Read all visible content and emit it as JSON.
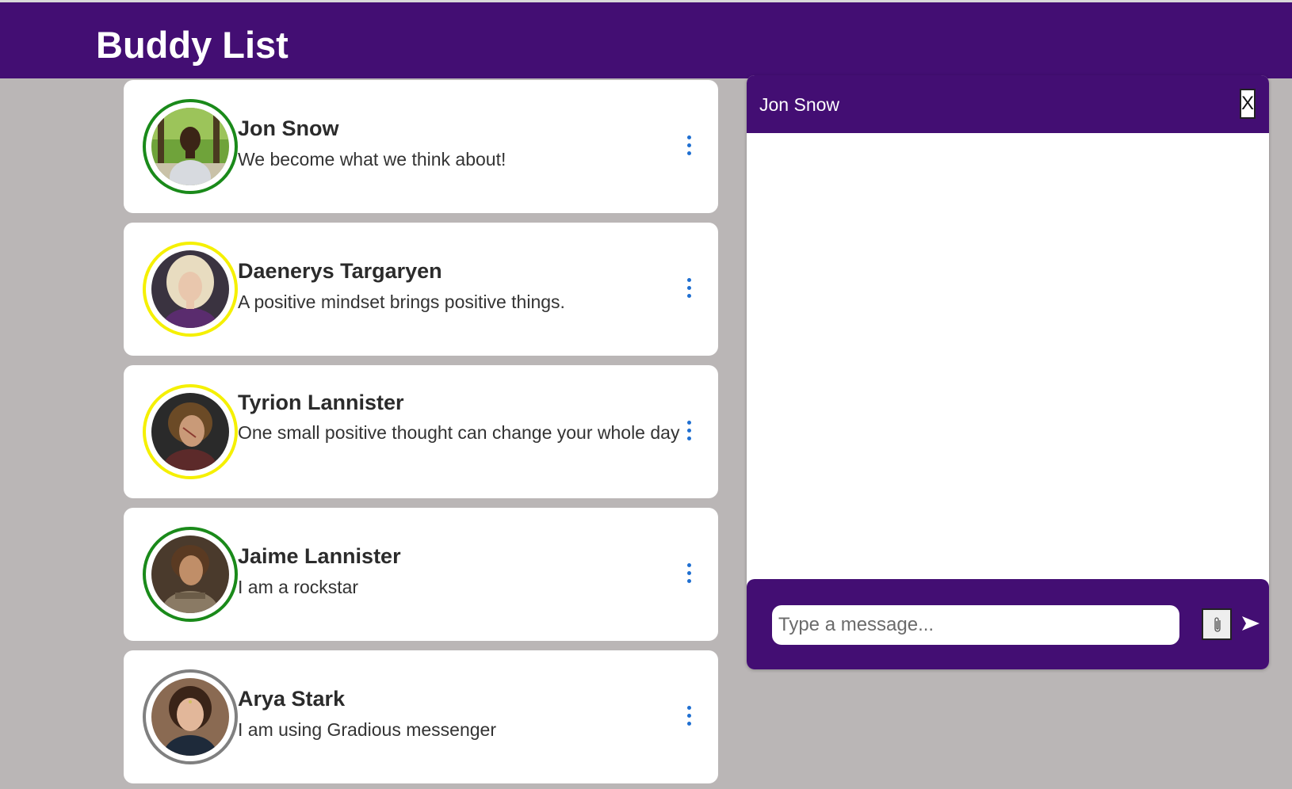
{
  "header": {
    "title": "Buddy List"
  },
  "buddies": [
    {
      "name": "Jon Snow",
      "status": "We become what we think about!",
      "presence": "online",
      "ring_color": "#1a8a1a"
    },
    {
      "name": "Daenerys Targaryen",
      "status": "A positive mindset brings positive things.",
      "presence": "away",
      "ring_color": "#f5f000"
    },
    {
      "name": "Tyrion Lannister",
      "status": "One small positive thought can change your whole day",
      "presence": "away",
      "ring_color": "#f5f000"
    },
    {
      "name": "Jaime Lannister",
      "status": "I am a rockstar",
      "presence": "online",
      "ring_color": "#1a8a1a"
    },
    {
      "name": "Arya Stark",
      "status": "I am using Gradious messenger",
      "presence": "offline",
      "ring_color": "#808080"
    }
  ],
  "chat": {
    "title": "Jon Snow",
    "close_label": "X",
    "input_value": "",
    "input_placeholder": "Type a message...",
    "attach_icon": "paperclip-icon",
    "send_icon": "send-arrow-icon"
  },
  "colors": {
    "brand": "#430e73",
    "background": "#bab6b6",
    "kebab": "#1f6fd1"
  }
}
